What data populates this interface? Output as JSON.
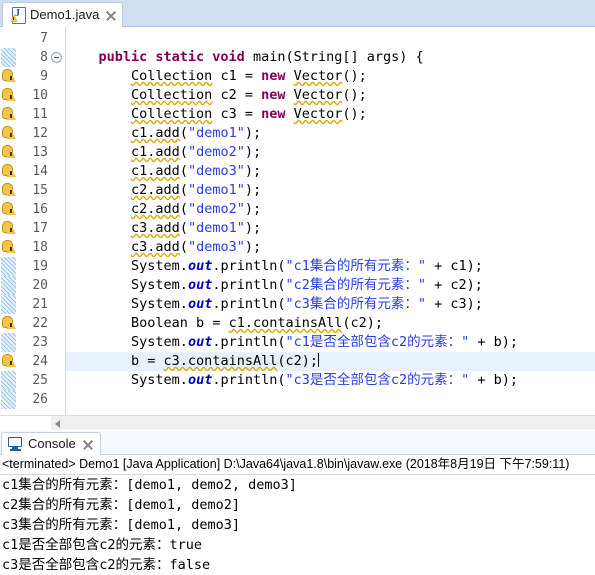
{
  "editor": {
    "tab": {
      "label": "Demo1.java",
      "icon": "java-file-icon",
      "close_icon": "close-icon",
      "warning_overlay_icon": "warning-overlay-icon"
    },
    "first_line_number": 7,
    "current_line": 24,
    "fold_marker_line": 8,
    "warning_lines": [
      9,
      10,
      11,
      12,
      13,
      14,
      15,
      16,
      17,
      18,
      22,
      24
    ],
    "lines": [
      {
        "num": 7,
        "tokens": []
      },
      {
        "num": 8,
        "tokens": [
          {
            "t": "    ",
            "c": "plain"
          },
          {
            "t": "public static void ",
            "c": "kw"
          },
          {
            "t": "main(String[] args) {",
            "c": "plain"
          }
        ]
      },
      {
        "num": 9,
        "tokens": [
          {
            "t": "        ",
            "c": "plain"
          },
          {
            "t": "Collection",
            "c": "plain-sq"
          },
          {
            "t": " c1 = ",
            "c": "plain"
          },
          {
            "t": "new ",
            "c": "kw"
          },
          {
            "t": "Vector",
            "c": "plain-sq"
          },
          {
            "t": "();",
            "c": "plain"
          }
        ]
      },
      {
        "num": 10,
        "tokens": [
          {
            "t": "        ",
            "c": "plain"
          },
          {
            "t": "Collection",
            "c": "plain-sq"
          },
          {
            "t": " c2 = ",
            "c": "plain"
          },
          {
            "t": "new ",
            "c": "kw"
          },
          {
            "t": "Vector",
            "c": "plain-sq"
          },
          {
            "t": "();",
            "c": "plain"
          }
        ]
      },
      {
        "num": 11,
        "tokens": [
          {
            "t": "        ",
            "c": "plain"
          },
          {
            "t": "Collection",
            "c": "plain-sq"
          },
          {
            "t": " c3 = ",
            "c": "plain"
          },
          {
            "t": "new ",
            "c": "kw"
          },
          {
            "t": "Vector",
            "c": "plain-sq"
          },
          {
            "t": "();",
            "c": "plain"
          }
        ]
      },
      {
        "num": 12,
        "tokens": [
          {
            "t": "        ",
            "c": "plain"
          },
          {
            "t": "c1.add",
            "c": "plain-sq"
          },
          {
            "t": "(",
            "c": "plain"
          },
          {
            "t": "\"demo1\"",
            "c": "str"
          },
          {
            "t": ");",
            "c": "plain"
          }
        ]
      },
      {
        "num": 13,
        "tokens": [
          {
            "t": "        ",
            "c": "plain"
          },
          {
            "t": "c1.add",
            "c": "plain-sq"
          },
          {
            "t": "(",
            "c": "plain"
          },
          {
            "t": "\"demo2\"",
            "c": "str"
          },
          {
            "t": ");",
            "c": "plain"
          }
        ]
      },
      {
        "num": 14,
        "tokens": [
          {
            "t": "        ",
            "c": "plain"
          },
          {
            "t": "c1.add",
            "c": "plain-sq"
          },
          {
            "t": "(",
            "c": "plain"
          },
          {
            "t": "\"demo3\"",
            "c": "str"
          },
          {
            "t": ");",
            "c": "plain"
          }
        ]
      },
      {
        "num": 15,
        "tokens": [
          {
            "t": "        ",
            "c": "plain"
          },
          {
            "t": "c2.add",
            "c": "plain-sq"
          },
          {
            "t": "(",
            "c": "plain"
          },
          {
            "t": "\"demo1\"",
            "c": "str"
          },
          {
            "t": ");",
            "c": "plain"
          }
        ]
      },
      {
        "num": 16,
        "tokens": [
          {
            "t": "        ",
            "c": "plain"
          },
          {
            "t": "c2.add",
            "c": "plain-sq"
          },
          {
            "t": "(",
            "c": "plain"
          },
          {
            "t": "\"demo2\"",
            "c": "str"
          },
          {
            "t": ");",
            "c": "plain"
          }
        ]
      },
      {
        "num": 17,
        "tokens": [
          {
            "t": "        ",
            "c": "plain"
          },
          {
            "t": "c3.add",
            "c": "plain-sq"
          },
          {
            "t": "(",
            "c": "plain"
          },
          {
            "t": "\"demo1\"",
            "c": "str"
          },
          {
            "t": ");",
            "c": "plain"
          }
        ]
      },
      {
        "num": 18,
        "tokens": [
          {
            "t": "        ",
            "c": "plain"
          },
          {
            "t": "c3.add",
            "c": "plain-sq"
          },
          {
            "t": "(",
            "c": "plain"
          },
          {
            "t": "\"demo3\"",
            "c": "str"
          },
          {
            "t": ");",
            "c": "plain"
          }
        ]
      },
      {
        "num": 19,
        "tokens": [
          {
            "t": "        ",
            "c": "plain"
          },
          {
            "t": "System.",
            "c": "plain"
          },
          {
            "t": "out",
            "c": "stat"
          },
          {
            "t": ".println(",
            "c": "plain"
          },
          {
            "t": "\"c1集合的所有元素：\"",
            "c": "str"
          },
          {
            "t": " + c1);",
            "c": "plain"
          }
        ]
      },
      {
        "num": 20,
        "tokens": [
          {
            "t": "        ",
            "c": "plain"
          },
          {
            "t": "System.",
            "c": "plain"
          },
          {
            "t": "out",
            "c": "stat"
          },
          {
            "t": ".println(",
            "c": "plain"
          },
          {
            "t": "\"c2集合的所有元素：\"",
            "c": "str"
          },
          {
            "t": " + c2);",
            "c": "plain"
          }
        ]
      },
      {
        "num": 21,
        "tokens": [
          {
            "t": "        ",
            "c": "plain"
          },
          {
            "t": "System.",
            "c": "plain"
          },
          {
            "t": "out",
            "c": "stat"
          },
          {
            "t": ".println(",
            "c": "plain"
          },
          {
            "t": "\"c3集合的所有元素：\"",
            "c": "str"
          },
          {
            "t": " + c3);",
            "c": "plain"
          }
        ]
      },
      {
        "num": 22,
        "tokens": [
          {
            "t": "        ",
            "c": "plain"
          },
          {
            "t": "Boolean b = ",
            "c": "plain"
          },
          {
            "t": "c1.containsAll",
            "c": "plain-sq"
          },
          {
            "t": "(c2);",
            "c": "plain"
          }
        ]
      },
      {
        "num": 23,
        "tokens": [
          {
            "t": "        ",
            "c": "plain"
          },
          {
            "t": "System.",
            "c": "plain"
          },
          {
            "t": "out",
            "c": "stat"
          },
          {
            "t": ".println(",
            "c": "plain"
          },
          {
            "t": "\"c1是否全部包含c2的元素：\"",
            "c": "str"
          },
          {
            "t": " + b);",
            "c": "plain"
          }
        ]
      },
      {
        "num": 24,
        "tokens": [
          {
            "t": "        ",
            "c": "plain"
          },
          {
            "t": "b = ",
            "c": "plain"
          },
          {
            "t": "c3.containsAll",
            "c": "plain-sq"
          },
          {
            "t": "(c2);",
            "c": "plain"
          }
        ]
      },
      {
        "num": 25,
        "tokens": [
          {
            "t": "        ",
            "c": "plain"
          },
          {
            "t": "System.",
            "c": "plain"
          },
          {
            "t": "out",
            "c": "stat"
          },
          {
            "t": ".println(",
            "c": "plain"
          },
          {
            "t": "\"c3是否全部包含c2的元素：\"",
            "c": "str"
          },
          {
            "t": " + b);",
            "c": "plain"
          }
        ]
      },
      {
        "num": 26,
        "tokens": []
      }
    ],
    "hscrollbar": {
      "left_arrow_icon": "scroll-left-arrow-icon"
    }
  },
  "console": {
    "tab": {
      "label": "Console",
      "icon": "console-monitor-icon",
      "close_icon": "close-icon"
    },
    "terminated_line": "<terminated> Demo1 [Java Application] D:\\Java64\\java1.8\\bin\\javaw.exe (2018年8月19日 下午7:59:11)",
    "output_lines": [
      "c1集合的所有元素：[demo1, demo2, demo3]",
      "c2集合的所有元素：[demo1, demo2]",
      "c3集合的所有元素：[demo1, demo3]",
      "c1是否全部包含c2的元素：true",
      "c3是否全部包含c2的元素：false"
    ]
  },
  "colors": {
    "tab_bar_active": "#cfdef0",
    "keyword": "#7f0055",
    "string": "#2a3cdd",
    "static_field": "#0000c0",
    "current_line_highlight": "#e8f1fb",
    "warning_squiggle": "#d8a900",
    "line_number": "#5a5a5a"
  }
}
